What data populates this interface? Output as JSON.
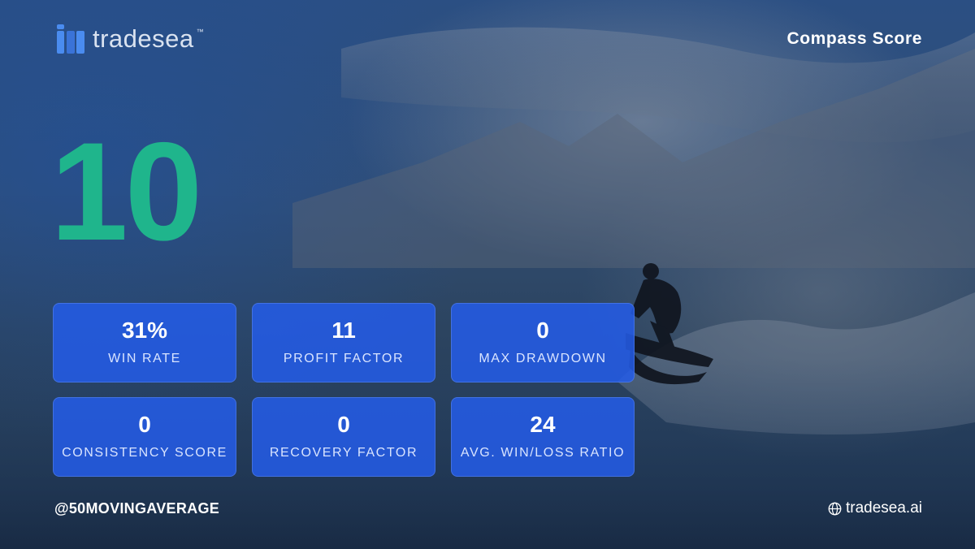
{
  "brand": {
    "name": "tradesea",
    "trademark": "™",
    "logo_color": "#4a8cf0"
  },
  "header": {
    "title": "Compass Score"
  },
  "score": {
    "value": "10",
    "color": "#1fb58c"
  },
  "metrics": [
    {
      "value": "31%",
      "label": "WIN RATE"
    },
    {
      "value": "11",
      "label": "PROFIT FACTOR"
    },
    {
      "value": "0",
      "label": "MAX DRAWDOWN"
    },
    {
      "value": "0",
      "label": "CONSISTENCY SCORE"
    },
    {
      "value": "0",
      "label": "RECOVERY FACTOR"
    },
    {
      "value": "24",
      "label": "AVG. WIN/LOSS RATIO"
    }
  ],
  "footer": {
    "handle": "@50MOVINGAVERAGE",
    "website": "tradesea.ai",
    "website_icon": "globe-icon"
  },
  "colors": {
    "tile_background": "#245ce8",
    "score": "#1fb58c"
  }
}
